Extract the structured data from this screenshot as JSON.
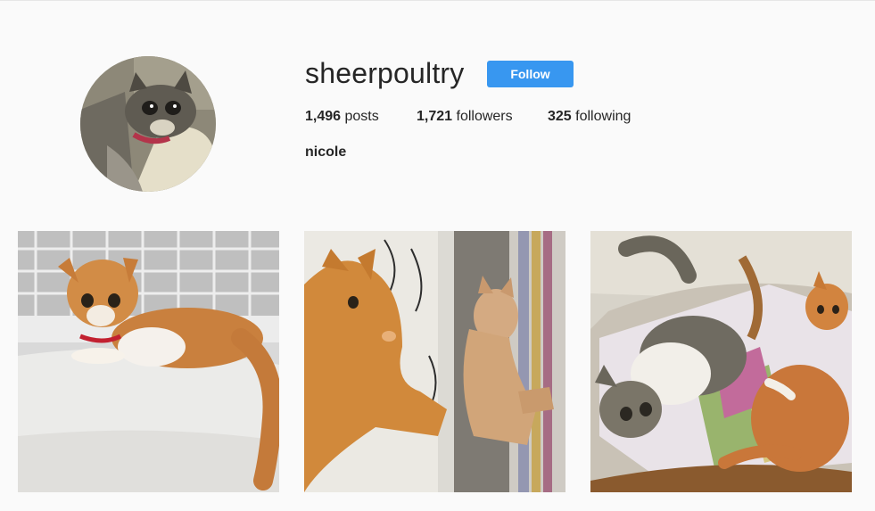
{
  "profile": {
    "username": "sheerpoultry",
    "follow_label": "Follow",
    "full_name": "nicole",
    "avatar_icon": "cat-avatar-photo"
  },
  "stats": {
    "posts_count": "1,496",
    "posts_label": "posts",
    "followers_count": "1,721",
    "followers_label": "followers",
    "following_count": "325",
    "following_label": "following"
  },
  "posts": [
    {
      "image": "cat-photo-ginger-on-couch"
    },
    {
      "image": "cat-photo-collage-window"
    },
    {
      "image": "cat-photo-two-cats-playing"
    }
  ],
  "colors": {
    "accent": "#3897f0",
    "background": "#fafafa",
    "text": "#262626"
  }
}
